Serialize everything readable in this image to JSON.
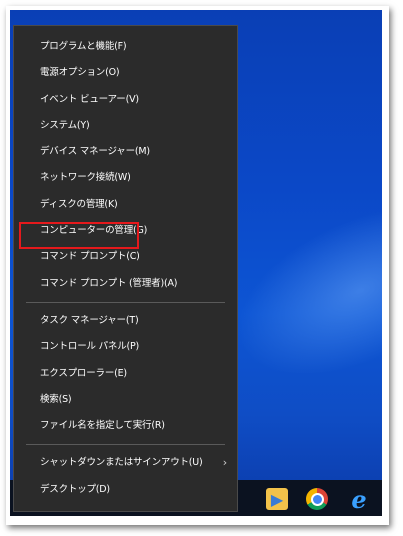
{
  "menu": {
    "group1": [
      {
        "id": "programs",
        "label": "プログラムと機能(F)"
      },
      {
        "id": "power",
        "label": "電源オプション(O)"
      },
      {
        "id": "eventviewer",
        "label": "イベント ビューアー(V)"
      },
      {
        "id": "system",
        "label": "システム(Y)"
      },
      {
        "id": "devicemanager",
        "label": "デバイス マネージャー(M)"
      },
      {
        "id": "network",
        "label": "ネットワーク接続(W)"
      },
      {
        "id": "diskmgmt",
        "label": "ディスクの管理(K)"
      },
      {
        "id": "computermgmt",
        "label": "コンピューターの管理(G)"
      },
      {
        "id": "cmd",
        "label": "コマンド プロンプト(C)"
      },
      {
        "id": "cmdadmin",
        "label": "コマンド プロンプト (管理者)(A)"
      }
    ],
    "group2": [
      {
        "id": "taskmgr",
        "label": "タスク マネージャー(T)"
      },
      {
        "id": "controlpanel",
        "label": "コントロール パネル(P)"
      },
      {
        "id": "explorer",
        "label": "エクスプローラー(E)"
      },
      {
        "id": "search",
        "label": "検索(S)"
      },
      {
        "id": "run",
        "label": "ファイル名を指定して実行(R)"
      }
    ],
    "group3": [
      {
        "id": "shutdown",
        "label": "シャットダウンまたはサインアウト(U)",
        "submenu": true
      },
      {
        "id": "desktop",
        "label": "デスクトップ(D)"
      }
    ],
    "submenu_arrow": "›"
  },
  "taskbar": {
    "icons": [
      "app-icon",
      "folder-media-icon",
      "chrome-icon",
      "internet-explorer-icon"
    ],
    "ie_glyph": "e"
  },
  "colors": {
    "menu_bg": "#2b2b2b",
    "highlight_border": "#e5191c",
    "desktop_blue": "#0b48c7"
  }
}
